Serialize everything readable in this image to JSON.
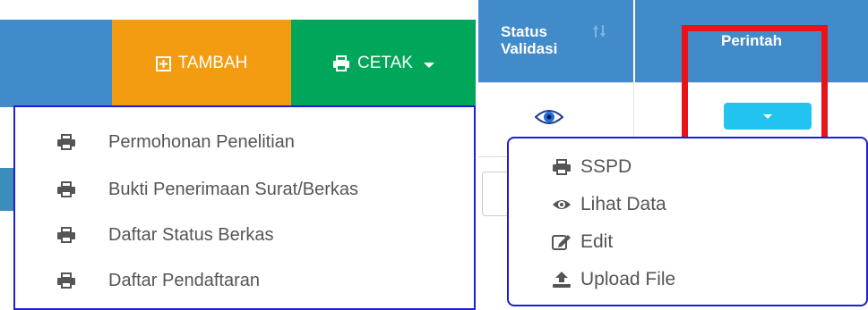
{
  "toolbar": {
    "tambah_label": "TAMBAH",
    "cetak_label": "CETAK"
  },
  "cetak_menu": {
    "items": [
      {
        "label": "Permohonan Penelitian",
        "icon": "print-icon"
      },
      {
        "label": "Bukti Penerimaan Surat/Berkas",
        "icon": "print-icon"
      },
      {
        "label": "Daftar Status Berkas",
        "icon": "print-icon"
      },
      {
        "label": "Daftar Pendaftaran",
        "icon": "print-icon"
      }
    ]
  },
  "table": {
    "headers": {
      "status_validasi": "Status Validasi",
      "perintah": "Perintah"
    }
  },
  "action_menu": {
    "items": [
      {
        "label": "SSPD",
        "icon": "print-icon"
      },
      {
        "label": "Lihat Data",
        "icon": "eye-icon"
      },
      {
        "label": "Edit",
        "icon": "edit-icon"
      },
      {
        "label": "Upload File",
        "icon": "upload-icon"
      }
    ]
  },
  "colors": {
    "primary": "#428bca",
    "tambah": "#f39c12",
    "cetak": "#00a65a",
    "info": "#22c3ef",
    "highlight": "#e8141c",
    "menu_border": "#1f1fcf"
  }
}
